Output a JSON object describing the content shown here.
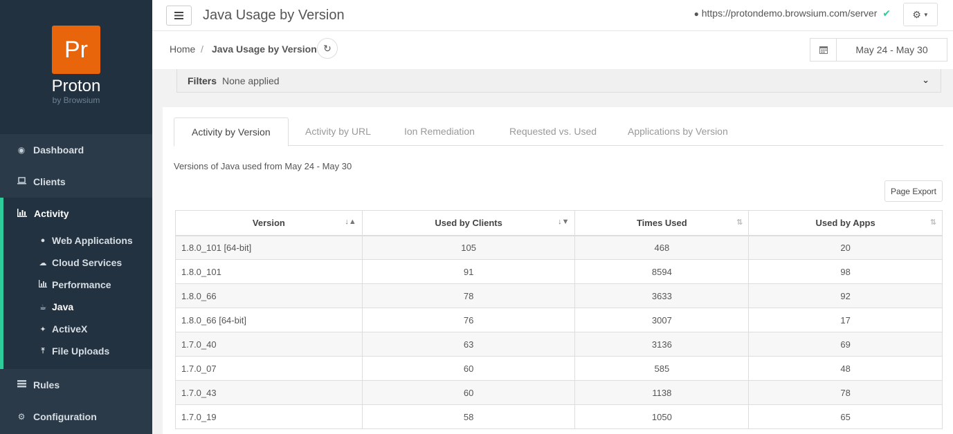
{
  "brand": {
    "logo_text": "Pr",
    "name": "Proton",
    "sub": "by Browsium"
  },
  "nav": {
    "dashboard": "Dashboard",
    "clients": "Clients",
    "activity": "Activity",
    "activity_items": [
      "Web Applications",
      "Cloud Services",
      "Performance",
      "Java",
      "ActiveX",
      "File Uploads"
    ],
    "rules": "Rules",
    "configuration": "Configuration"
  },
  "header": {
    "title": "Java Usage by Version",
    "server_url": "https://protondemo.browsium.com/server"
  },
  "breadcrumb": {
    "home": "Home",
    "sep": "/",
    "current": "Java Usage by Version"
  },
  "date_range": "May 24 - May 30",
  "filters": {
    "label": "Filters",
    "value": "None applied"
  },
  "tabs": [
    "Activity by Version",
    "Activity by URL",
    "Ion Remediation",
    "Requested vs. Used",
    "Applications by Version"
  ],
  "description": "Versions of Java used from May 24 - May 30",
  "export_label": "Page Export",
  "table": {
    "headers": [
      "Version",
      "Used by Clients",
      "Times Used",
      "Used by Apps"
    ],
    "rows": [
      [
        "1.8.0_101 [64-bit]",
        "105",
        "468",
        "20"
      ],
      [
        "1.8.0_101",
        "91",
        "8594",
        "98"
      ],
      [
        "1.8.0_66",
        "78",
        "3633",
        "92"
      ],
      [
        "1.8.0_66 [64-bit]",
        "76",
        "3007",
        "17"
      ],
      [
        "1.7.0_40",
        "63",
        "3136",
        "69"
      ],
      [
        "1.7.0_07",
        "60",
        "585",
        "48"
      ],
      [
        "1.7.0_43",
        "60",
        "1138",
        "78"
      ],
      [
        "1.7.0_19",
        "58",
        "1050",
        "65"
      ]
    ]
  },
  "colors": {
    "accent": "#2ecc9a",
    "logo": "#e8650c",
    "sidebar": "#2b3a48"
  }
}
